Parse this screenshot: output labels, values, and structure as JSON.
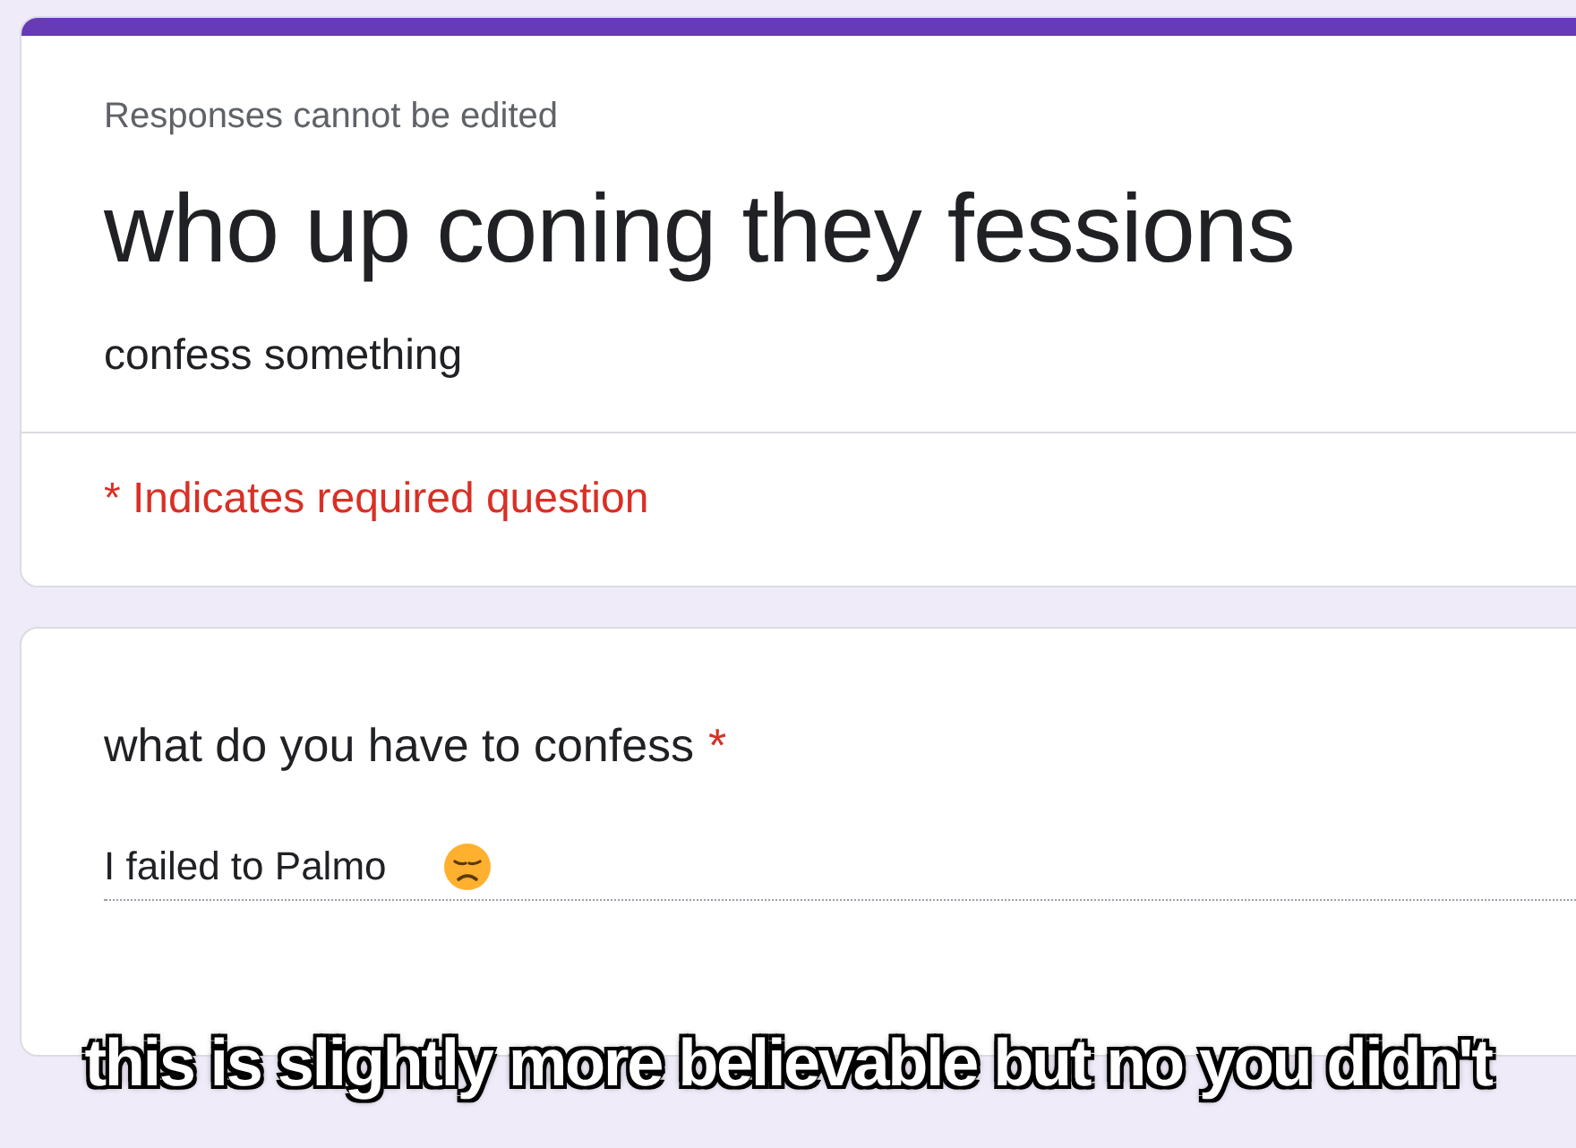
{
  "form": {
    "notice": "Responses cannot be edited",
    "title": "who up coning they fessions",
    "description": "confess something",
    "required_note": "* Indicates required question"
  },
  "questions": [
    {
      "label": "what do you have to confess",
      "required": true,
      "required_mark": "*",
      "answer": "I failed to Palmo"
    }
  ],
  "caption": "this is slightly more believable but no you didn't"
}
